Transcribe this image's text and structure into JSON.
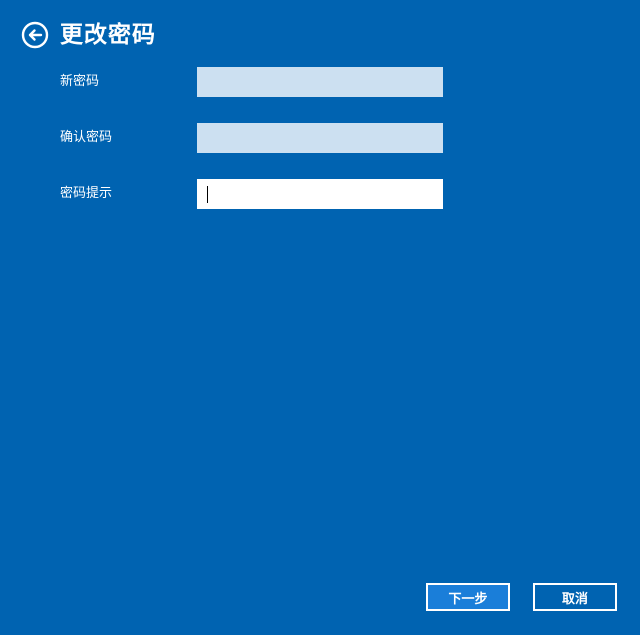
{
  "header": {
    "title": "更改密码",
    "back_icon": "back-arrow-icon"
  },
  "form": {
    "new_password": {
      "label": "新密码",
      "value": ""
    },
    "confirm_password": {
      "label": "确认密码",
      "value": ""
    },
    "password_hint": {
      "label": "密码提示",
      "value": ""
    }
  },
  "buttons": {
    "next": "下一步",
    "cancel": "取消"
  },
  "colors": {
    "background": "#0063b1",
    "inactive_field": "#cce0f1",
    "active_field": "#ffffff",
    "primary_button": "#1a7ed9"
  }
}
